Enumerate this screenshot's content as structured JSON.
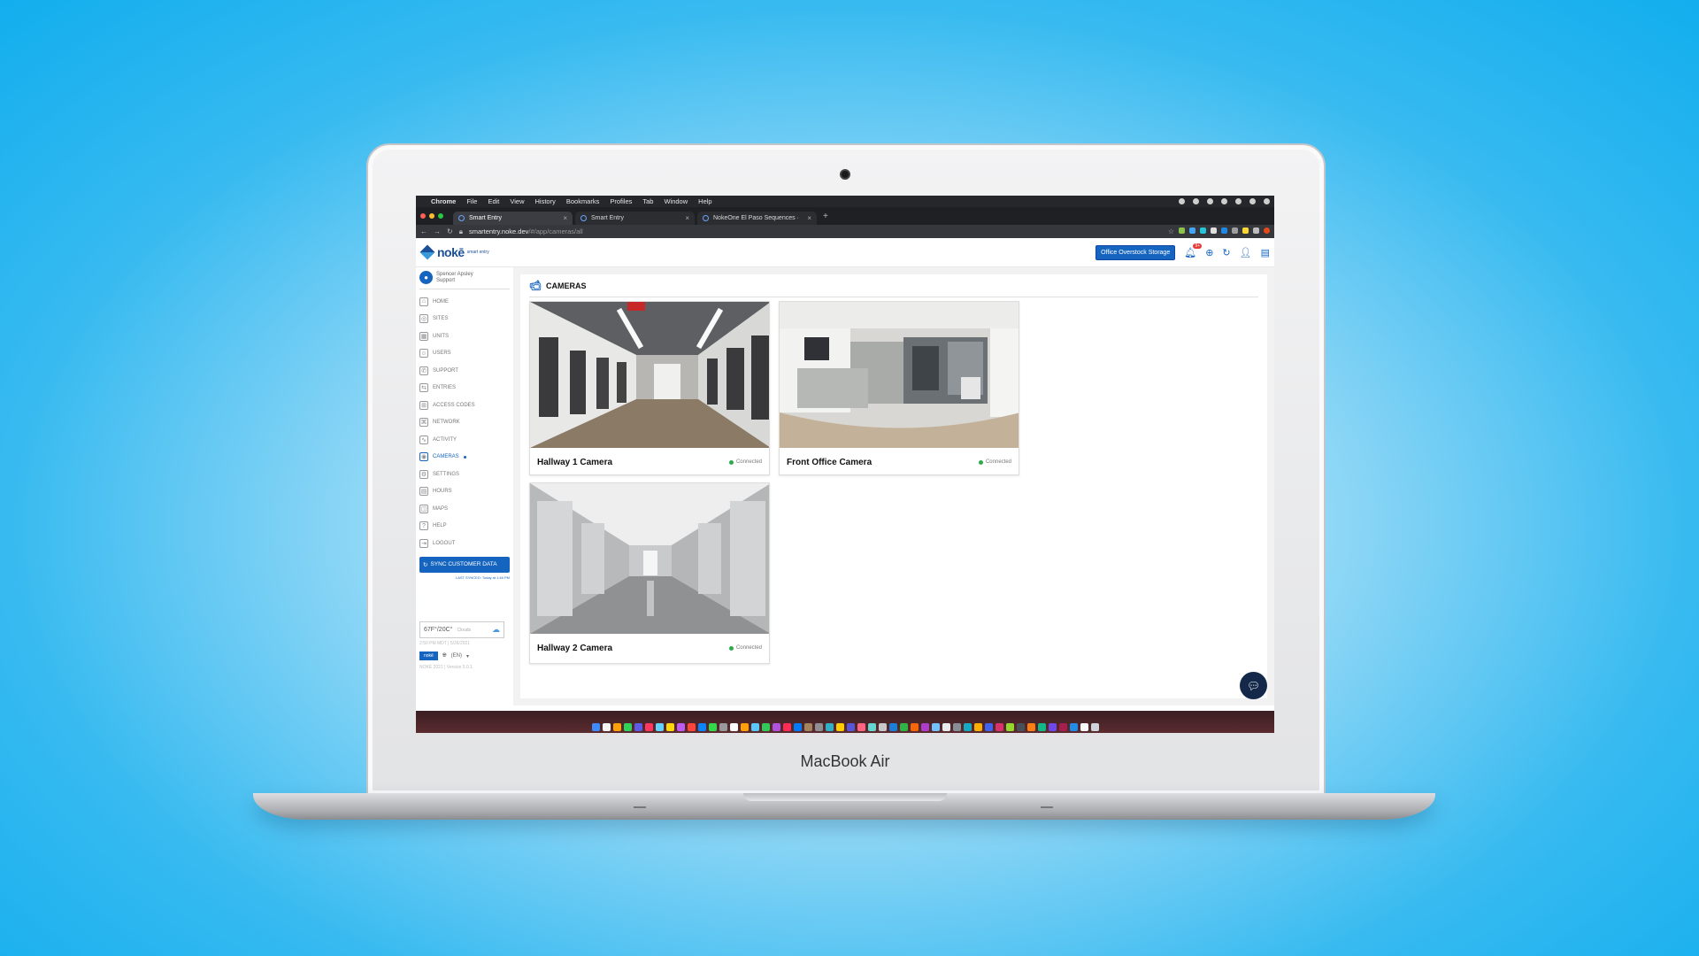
{
  "device": {
    "label": "MacBook Air"
  },
  "mac_menubar": {
    "app": "Chrome",
    "items": [
      "File",
      "Edit",
      "View",
      "History",
      "Bookmarks",
      "Profiles",
      "Tab",
      "Window",
      "Help"
    ]
  },
  "browser": {
    "tabs": [
      {
        "title": "Smart Entry",
        "active": true
      },
      {
        "title": "Smart Entry",
        "active": false
      },
      {
        "title": "NokeOne El Paso Sequences · ",
        "active": false
      }
    ],
    "url_host": "smartentry.noke.dev",
    "url_path": "/#/app/cameras/all"
  },
  "header": {
    "logo_text": "nokē",
    "logo_sub": "smart entry",
    "site_button": "Office Overstock Storage",
    "notification_count": "9+"
  },
  "user": {
    "name": "Spencer Apsley",
    "role": "Support"
  },
  "nav": [
    {
      "label": "HOME",
      "icon": "home-icon"
    },
    {
      "label": "SITES",
      "icon": "sites-icon"
    },
    {
      "label": "UNITS",
      "icon": "units-icon"
    },
    {
      "label": "USERS",
      "icon": "users-icon"
    },
    {
      "label": "SUPPORT",
      "icon": "support-icon"
    },
    {
      "label": "ENTRIES",
      "icon": "entries-icon"
    },
    {
      "label": "ACCESS CODES",
      "icon": "keypad-icon"
    },
    {
      "label": "NETWORK",
      "icon": "network-icon"
    },
    {
      "label": "ACTIVITY",
      "icon": "activity-icon"
    },
    {
      "label": "CAMERAS",
      "icon": "camera-icon",
      "active": true
    },
    {
      "label": "SETTINGS",
      "icon": "settings-icon"
    },
    {
      "label": "HOURS",
      "icon": "calendar-icon"
    },
    {
      "label": "MAPS",
      "icon": "map-icon"
    },
    {
      "label": "HELP",
      "icon": "help-icon"
    },
    {
      "label": "LOGOUT",
      "icon": "logout-icon"
    }
  ],
  "sync": {
    "label": "SYNC CUSTOMER DATA",
    "last_synced": "LAST SYNCED: Today at 1:46 PM"
  },
  "weather": {
    "temp": "67F°/20C°",
    "condition": "Clouds",
    "time": "2:50 PM MDT | 5/26/2021"
  },
  "footer": {
    "language": "(EN)",
    "version": "NOKĒ 2021 | Version 5.0.1"
  },
  "page": {
    "title": "CAMERAS"
  },
  "cameras": [
    {
      "name": "Hallway 1 Camera",
      "status": "Connected"
    },
    {
      "name": "Front Office Camera",
      "status": "Connected"
    },
    {
      "name": "Hallway 2 Camera",
      "status": "Connected"
    }
  ],
  "colors": {
    "accent": "#1565c0",
    "connected": "#2eaa4c",
    "background": "#12aeee"
  }
}
